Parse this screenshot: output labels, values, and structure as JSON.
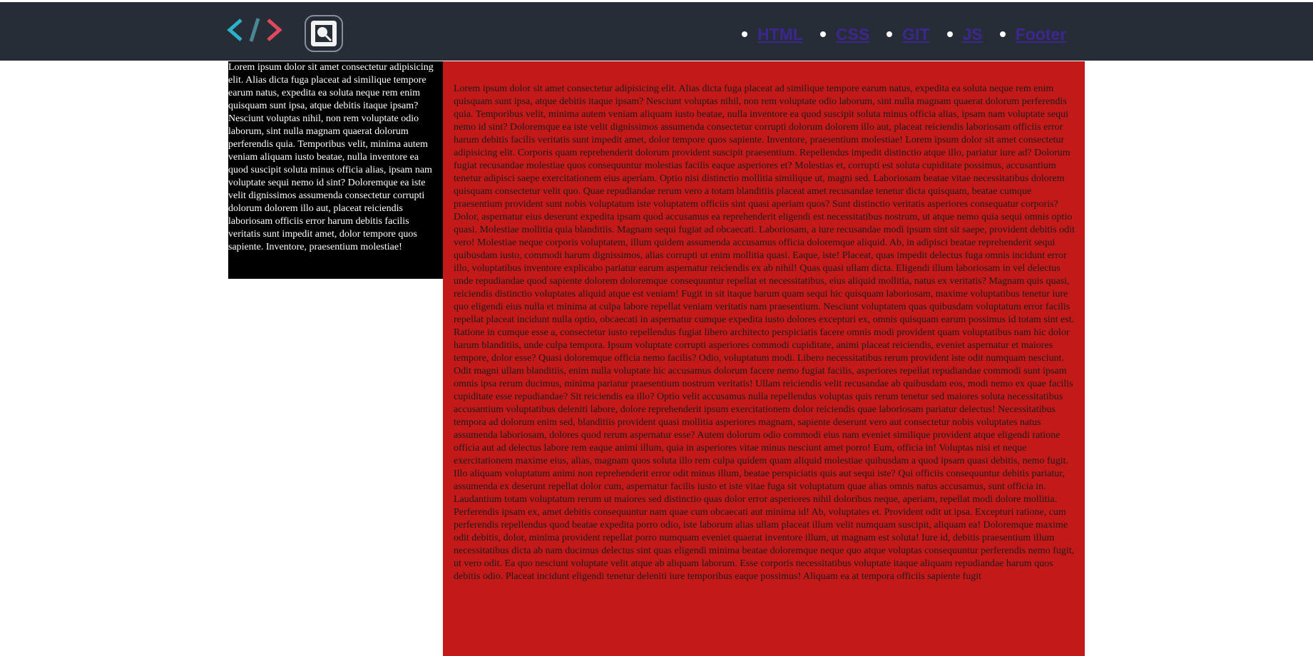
{
  "header": {
    "logo_icon": "code-brackets-icon",
    "search_icon": "search-icon",
    "nav": [
      {
        "label": "HTML"
      },
      {
        "label": "CSS"
      },
      {
        "label": "GIT"
      },
      {
        "label": "JS"
      },
      {
        "label": "Footer"
      }
    ]
  },
  "colors": {
    "header_bg": "#272d36",
    "sidebar_bg": "#000000",
    "main_bg": "#c41919",
    "link": "#3d2691"
  },
  "sidebar": {
    "text": "Lorem ipsum dolor sit amet consectetur adipisicing elit. Alias dicta fuga placeat ad similique tempore earum natus, expedita ea soluta neque rem enim quisquam sunt ipsa, atque debitis itaque ipsam? Nesciunt voluptas nihil, non rem voluptate odio laborum, sint nulla magnam quaerat dolorum perferendis quia. Temporibus velit, minima autem veniam aliquam iusto beatae, nulla inventore ea quod suscipit soluta minus officia alias, ipsam nam voluptate sequi nemo id sint? Doloremque ea iste velit dignissimos assumenda consectetur corrupti dolorum dolorem illo aut, placeat reiciendis laboriosam officiis error harum debitis facilis veritatis sunt impedit amet, dolor tempore quos sapiente. Inventore, praesentium molestiae!"
  },
  "main": {
    "text": "Lorem ipsum dolor sit amet consectetur adipisicing elit. Alias dicta fuga placeat ad similique tempore earum natus, expedita ea soluta neque rem enim quisquam sunt ipsa, atque debitis itaque ipsam? Nesciunt voluptas nihil, non rem voluptate odio laborum, sint nulla magnam quaerat dolorum perferendis quia. Temporibus velit, minima autem veniam aliquam iusto beatae, nulla inventore ea quod suscipit soluta minus officia alias, ipsam nam voluptate sequi nemo id sint? Doloremque ea iste velit dignissimos assumenda consectetur corrupti dolorum dolorem illo aut, placeat reiciendis laboriosam officiis error harum debitis facilis veritatis sunt impedit amet, dolor tempore quos sapiente. Inventore, praesentium molestiae! Lorem ipsum dolor sit amet consectetur adipisicing elit. Corporis quam reprehenderit dolorum provident suscipit praesentium. Repellendus impedit distinctio atque illo, pariatur iure ad? Dolorum fugiat recusandae molestiae quos consequuntur molestias facilis eaque asperiores et? Molestias et, corrupti est soluta cupiditate possimus, accusantium tenetur adipisci saepe exercitationem eius aperiam. Optio nisi distinctio mollitia similique ut, magni sed. Laboriosam beatae vitae necessitatibus dolorem quisquam consectetur velit quo. Quae repudiandae rerum vero a totam blanditiis placeat amet recusandae tenetur dicta quisquam, beatae cumque praesentium provident sunt nobis voluptatum iste voluptatem officiis sint quasi aperiam quos? Sunt distinctio veritatis asperiores consequatur corporis? Dolor, aspernatur eius deserunt expedita ipsam quod accusamus ea reprehenderit eligendi est necessitatibus nostrum, ut atque nemo quia sequi omnis optio quasi. Molestiae mollitia quia blanditiis. Magnam sequi fugiat ad obcaecati. Laboriosam, a iure recusandae modi ipsum sint sit saepe, provident debitis odit vero! Molestiae neque corporis voluptatem, illum quidem assumenda accusamus officia doloremque aliquid. Ab, in adipisci beatae reprehenderit sequi quibusdam iusto, commodi harum dignissimos, alias corrupti ut enim mollitia quasi. Eaque, iste! Placeat, quas impedit delectus fuga omnis incidunt error illo, voluptatibus inventore explicabo pariatur earum aspernatur reiciendis ex ab nihil! Quas quasi ullam dicta. Eligendi illum laboriosam in vel delectus unde repudiandae quod sapiente dolorem doloremque consequuntur repellat et necessitatibus, eius aliquid mollitia, natus ex veritatis? Magnam quis quasi, reiciendis distinctio voluptates aliquid atque est veniam! Fugit in sit itaque harum quam sequi hic quisquam laboriosam, maxime voluptatibus tenetur iure quo eligendi eius nulla et minima at culpa labore repellat veniam veritatis nam praesentium. Nesciunt voluptatem quas quibusdam voluptatum error facilis repellat placeat incidunt nulla optio, obcaecati in aspernatur cumque expedita iusto dolores excepturi ex, omnis quisquam earum possimus id totam sint est. Ratione in cumque esse a, consectetur iusto repellendus fugiat libero architecto perspiciatis facere omnis modi provident quam voluptatibus nam hic dolor harum blanditiis, unde culpa tempora. Ipsum voluptate corrupti asperiores commodi cupiditate, animi placeat reiciendis, eveniet aspernatur et maiores tempore, dolor esse? Quasi doloremque officia nemo facilis? Odio, voluptatum modi. Libero necessitatibus rerum provident iste odit numquam nesciunt. Odit magni ullam blanditiis, enim nulla voluptate hic accusamus dolorum facere nemo fugiat facilis, asperiores repellat repudiandae commodi sunt ipsam omnis ipsa rerum ducimus, minima pariatur praesentium nostrum veritatis! Ullam reiciendis velit recusandae ab quibusdam eos, modi nemo ex quae facilis cupiditate esse repudiandae? Sit reiciendis ea illo? Optio velit accusamus nulla repellendus voluptas quis rerum tenetur sed maiores soluta necessitatibus accusantium voluptatibus deleniti labore, dolore reprehenderit ipsum exercitationem dolor reiciendis quae laboriosam pariatur delectus! Necessitatibus tempora ad dolorum enim sed, blanditiis provident quasi mollitia asperiores magnam, sapiente deserunt vero aut consectetur nobis voluptates natus assumenda laboriosam, dolores quod rerum aspernatur esse? Autem dolorum odio commodi eius nam eveniet similique provident atque eligendi ratione officia aut ad delectus labore rem eaque animi illum, quia in asperiores vitae minus nesciunt amet porro! Eum, officia in! Voluptas nisi et neque exercitationem maxime eius, alias, magnam quos soluta illo rem culpa quidem quam aliquid molestiae quibusdam a quod ipsam quasi debitis, nemo fugit. Illo aliquam voluptatum animi non reprehenderit error odit minus illum, beatae perspiciatis quis aut sequi iste? Qui officiis consequuntur debitis pariatur, assumenda ex deserunt repellat dolor cum, aspernatur facilis iusto et iste vitae fuga sit voluptatum quae alias omnis natus accusamus, sunt officia in. Laudantium totam voluptatum rerum ut maiores sed distinctio quas dolor error asperiores nihil doloribus neque, aperiam, repellat modi dolore mollitia. Perferendis ipsam ex, amet debitis consequuntur nam quae cum obcaecati aut minima id! Ab, voluptates et. Provident odit ut ipsa. Excepturi ratione, cum perferendis repellendus quod beatae expedita porro odio, iste laborum alias ullam placeat illum velit numquam suscipit, aliquam ea! Doloremque maxime odit debitis, dolor, minima provident repellat porro numquam eveniet quaerat inventore illum, ut magnam est soluta! Iure id, debitis praesentium illum necessitatibus dicta ab nam ducimus delectus sint quas eligendi minima beatae doloremque neque quo atque voluptas consequuntur perferendis nemo fugit, ut vero odit. Ea quo nesciunt voluptate velit atque ab aliquam laborum. Esse corporis necessitatibus voluptate itaque aliquam repudiandae harum quos debitis odio. Placeat incidunt eligendi tenetur deleniti iure temporibus eaque possimus! Aliquam ea at tempora officiis sapiente fugit"
  }
}
